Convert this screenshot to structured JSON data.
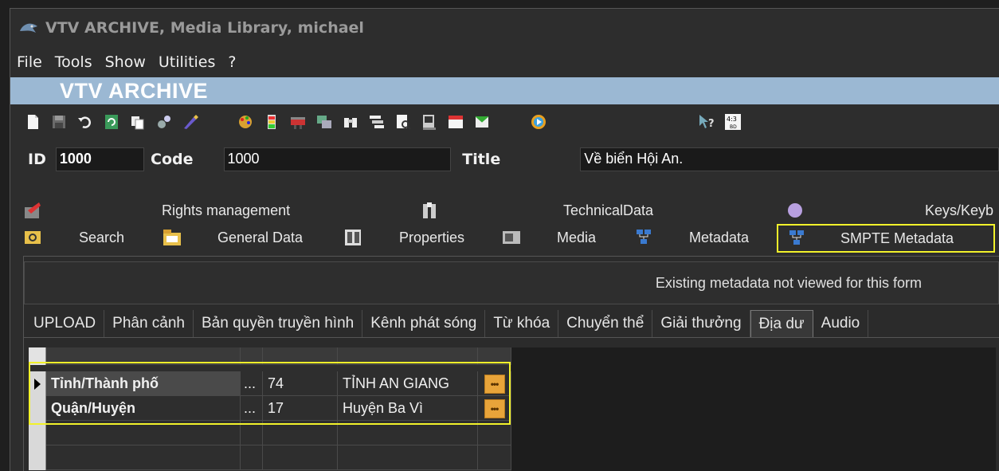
{
  "window": {
    "title": "VTV ARCHIVE, Media Library, michael"
  },
  "menu": [
    "File",
    "Tools",
    "Show",
    "Utilities",
    "?"
  ],
  "banner": "VTV ARCHIVE",
  "toolbar_icons": [
    "new-icon",
    "save-icon",
    "undo-icon",
    "refresh-icon",
    "copy-icon",
    "tools-icon",
    "edit-icon",
    "palette-icon",
    "battery-icon",
    "film-icon",
    "grid-icon",
    "binoculars-icon",
    "list-icon",
    "preview-icon",
    "device-icon",
    "abc-icon",
    "archive-icon",
    "play-icon",
    "help-icon",
    "aspect-ratio-icon"
  ],
  "aspect_label": "4:3",
  "record": {
    "id_label": "ID",
    "id_value": "1000",
    "code_label": "Code",
    "code_value": "1000",
    "title_label": "Title",
    "title_value": "Về biển Hội An."
  },
  "tabs_row1": [
    "Rights management",
    "TechnicalData",
    "Keys/Keyb"
  ],
  "tabs_row2": [
    "Search",
    "General Data",
    "Properties",
    "Media",
    "Metadata",
    "SMPTE Metadata"
  ],
  "notice": "Existing metadata not viewed for this form",
  "subtabs": [
    "UPLOAD",
    "Phân cảnh",
    "Bản quyền truyền hình",
    "Kênh phát sóng",
    "Từ khóa",
    "Chuyển thể",
    "Giải thưởng",
    "Địa dư",
    "Audio"
  ],
  "active_subtab": "Địa dư",
  "grid": {
    "rows": [
      {
        "name": "Tỉnh/Thành phố",
        "dots": "...",
        "code": "74",
        "value": "TỈNH AN GIANG",
        "button": "•••"
      },
      {
        "name": "Quận/Huyện",
        "dots": "...",
        "code": "17",
        "value": "Huyện Ba Vì",
        "button": "•••"
      }
    ]
  },
  "colors": {
    "banner": "#9bb8d3",
    "highlight": "#f2f22a",
    "button": "#e8a43a"
  }
}
